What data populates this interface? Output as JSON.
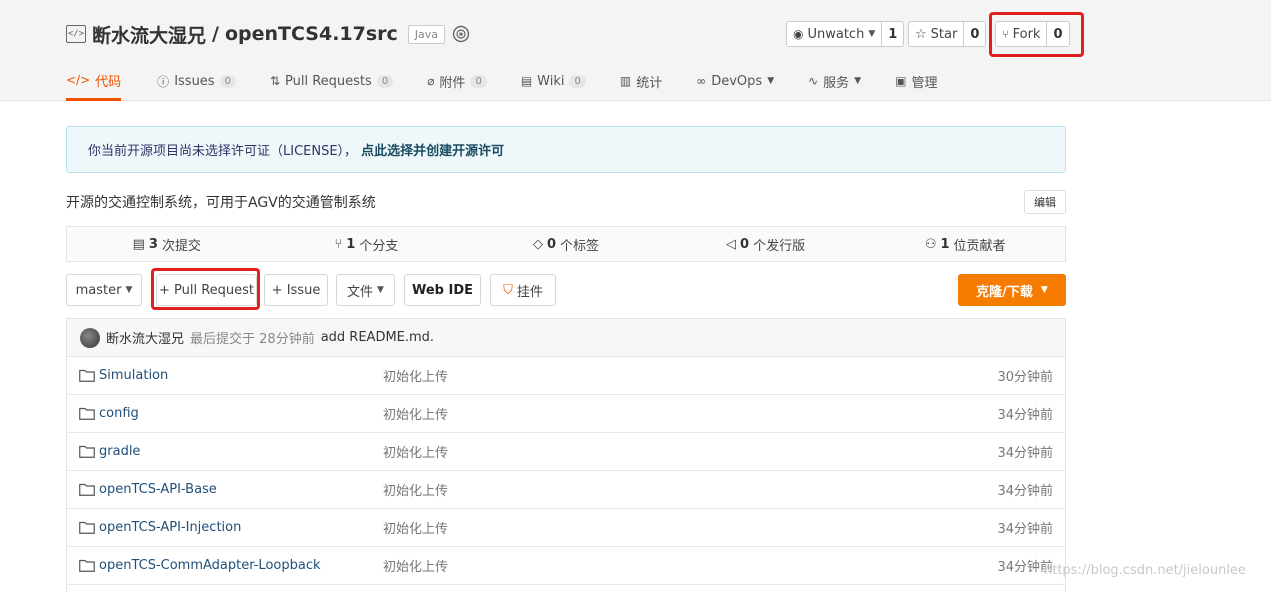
{
  "repo": {
    "owner": "断水流大湿兄",
    "separator": "/",
    "name": "openTCS4.17src",
    "language": "Java"
  },
  "social": {
    "watch_label": "Unwatch",
    "watch_count": "1",
    "star_label": "Star",
    "star_count": "0",
    "fork_label": "Fork",
    "fork_count": "0"
  },
  "tabs": [
    {
      "label": "代码",
      "icon": "code-icon",
      "count": ""
    },
    {
      "label": "Issues",
      "icon": "issue-icon",
      "count": "0"
    },
    {
      "label": "Pull Requests",
      "icon": "pull-request-icon",
      "count": "0"
    },
    {
      "label": "附件",
      "icon": "attachment-icon",
      "count": "0"
    },
    {
      "label": "Wiki",
      "icon": "wiki-icon",
      "count": "0"
    },
    {
      "label": "统计",
      "icon": "stats-icon",
      "count": ""
    },
    {
      "label": "DevOps",
      "icon": "devops-icon",
      "count": ""
    },
    {
      "label": "服务",
      "icon": "service-icon",
      "count": ""
    },
    {
      "label": "管理",
      "icon": "manage-icon",
      "count": ""
    }
  ],
  "license": {
    "text": "你当前开源项目尚未选择许可证（LICENSE），",
    "link": "点此选择并创建开源许可"
  },
  "description": "开源的交通控制系统，可用于AGV的交通管制系统",
  "edit_label": "编辑",
  "stats": [
    {
      "count": "3",
      "label": "次提交"
    },
    {
      "count": "1",
      "label": "个分支"
    },
    {
      "count": "0",
      "label": "个标签"
    },
    {
      "count": "0",
      "label": "个发行版"
    },
    {
      "count": "1",
      "label": "位贡献者"
    }
  ],
  "toolbar": {
    "branch": "master",
    "pull_request": "+ Pull Request",
    "issue": "+ Issue",
    "files": "文件",
    "web_ide": "Web IDE",
    "widget": "挂件",
    "clone": "克隆/下载"
  },
  "commit": {
    "author": "断水流大湿兄",
    "meta": "最后提交于 28分钟前",
    "message": "add README.md."
  },
  "files": [
    {
      "name": "Simulation",
      "message": "初始化上传",
      "time": "30分钟前"
    },
    {
      "name": "config",
      "message": "初始化上传",
      "time": "34分钟前"
    },
    {
      "name": "gradle",
      "message": "初始化上传",
      "time": "34分钟前"
    },
    {
      "name": "openTCS-API-Base",
      "message": "初始化上传",
      "time": "34分钟前"
    },
    {
      "name": "openTCS-API-Injection",
      "message": "初始化上传",
      "time": "34分钟前"
    },
    {
      "name": "openTCS-CommAdapter-Loopback",
      "message": "初始化上传",
      "time": "34分钟前"
    }
  ],
  "watermark": "https://blog.csdn.net/jielounlee",
  "colors": {
    "accent": "#f05000",
    "clone_button": "#f57c00",
    "highlight": "#e02020",
    "link": "#20507a"
  }
}
